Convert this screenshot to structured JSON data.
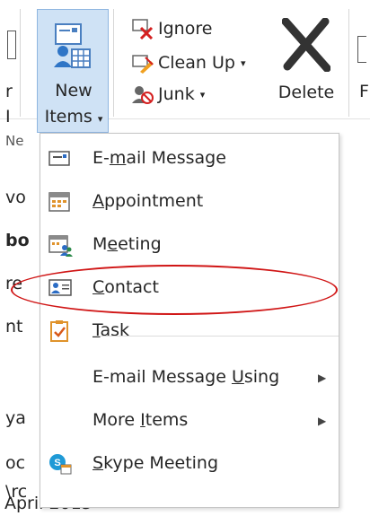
{
  "ribbon": {
    "new_items": {
      "line1": "New",
      "line2": "Items"
    },
    "ignore": "Ignore",
    "clean_up": "Clean Up",
    "junk": "Junk",
    "delete": "Delete",
    "left_fragments": {
      "r": "r",
      "l": "I",
      "ne": "Ne"
    },
    "right_fragment": "F"
  },
  "background_fragments": [
    "vo",
    "bo",
    "re",
    "nt",
    "ya",
    "oc",
    "\\rc",
    "April 2015"
  ],
  "menu": {
    "items": [
      {
        "pre": "E-",
        "key": "m",
        "post": "ail Message",
        "icon": "email-icon"
      },
      {
        "pre": "",
        "key": "A",
        "post": "ppointment",
        "icon": "calendar-icon"
      },
      {
        "pre": "M",
        "key": "e",
        "post": "eting",
        "icon": "meeting-icon"
      },
      {
        "pre": "",
        "key": "C",
        "post": "ontact",
        "icon": "contact-card-icon"
      },
      {
        "pre": "",
        "key": "T",
        "post": "ask",
        "icon": "task-icon"
      },
      {
        "pre": "E-mail Message ",
        "key": "U",
        "post": "sing",
        "icon": ""
      },
      {
        "pre": "More ",
        "key": "I",
        "post": "tems",
        "icon": ""
      },
      {
        "pre": "",
        "key": "S",
        "post": "kype Meeting",
        "icon": "skype-icon"
      }
    ],
    "caret": "▾",
    "submenu_arrow": "▶"
  },
  "colors": {
    "selected_button_bg": "#cfe2f5",
    "selected_button_border": "#8fb6e0",
    "annotation": "#d01515",
    "accent_blue": "#2b6cc4",
    "task_orange": "#e0932b"
  }
}
